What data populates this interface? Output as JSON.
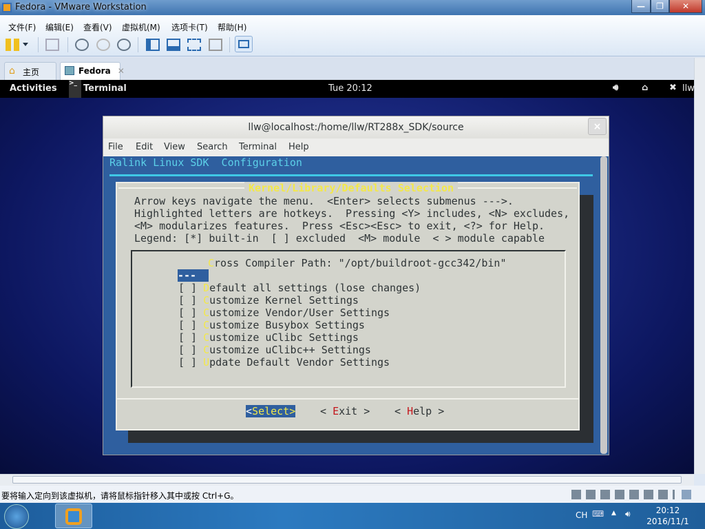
{
  "window": {
    "title": "Fedora - VMware Workstation",
    "minimize": "—",
    "restore": "❐",
    "close": "✕"
  },
  "menu": [
    "文件(F)",
    "编辑(E)",
    "查看(V)",
    "虚拟机(M)",
    "选项卡(T)",
    "帮助(H)"
  ],
  "tabs": [
    {
      "label": "主页",
      "close": "✕"
    },
    {
      "label": "Fedora",
      "close": "✕"
    }
  ],
  "gnome": {
    "activities": "Activities",
    "app": "Terminal",
    "clock": "Tue 20:12",
    "user": "llw"
  },
  "terminal": {
    "title": "llw@localhost:/home/llw/RT288x_SDK/source",
    "close": "×",
    "menu": [
      "File",
      "Edit",
      "View",
      "Search",
      "Terminal",
      "Help"
    ],
    "header": "Ralink Linux SDK  Configuration",
    "dialog_title": "Kernel/Library/Defaults Selection",
    "help_lines": [
      "Arrow keys navigate the menu.  <Enter> selects submenus --->.",
      "Highlighted letters are hotkeys.  Pressing <Y> includes, <N> excludes,",
      "<M> modularizes features.  Press <Esc><Esc> to exit, <?> for Help.",
      "Legend: [*] built-in  [ ] excluded  <M> module  < > module capable"
    ],
    "cross_compiler": {
      "hotkey": "C",
      "rest": "ross Compiler Path: \"/opt/buildroot-gcc342/bin\""
    },
    "separator": "---",
    "items": [
      {
        "check": "[ ] ",
        "hotkey": "D",
        "rest": "efault all settings (lose changes)"
      },
      {
        "check": "[ ] ",
        "hotkey": "C",
        "rest": "ustomize Kernel Settings"
      },
      {
        "check": "[ ] ",
        "hotkey": "C",
        "rest": "ustomize Vendor/User Settings"
      },
      {
        "check": "[ ] ",
        "hotkey": "C",
        "rest": "ustomize Busybox Settings"
      },
      {
        "check": "[ ] ",
        "hotkey": "C",
        "rest": "ustomize uClibc Settings"
      },
      {
        "check": "[ ] ",
        "hotkey": "C",
        "rest": "ustomize uClibc++ Settings"
      },
      {
        "check": "[ ] ",
        "hotkey": "U",
        "rest": "pdate Default Vendor Settings"
      }
    ],
    "buttons": {
      "select": {
        "pre": "<",
        "hk": "S",
        "rest": "elect>"
      },
      "exit": {
        "pre": "< ",
        "hk": "E",
        "rest": "xit >"
      },
      "help": {
        "pre": "< ",
        "hk": "H",
        "rest": "elp >"
      }
    }
  },
  "statusbar": {
    "message": "要将输入定向到该虚拟机，请将鼠标指针移入其中或按 Ctrl+G。"
  },
  "taskbar": {
    "lang": "CH",
    "time": "20:12",
    "date": "2016/11/1"
  }
}
